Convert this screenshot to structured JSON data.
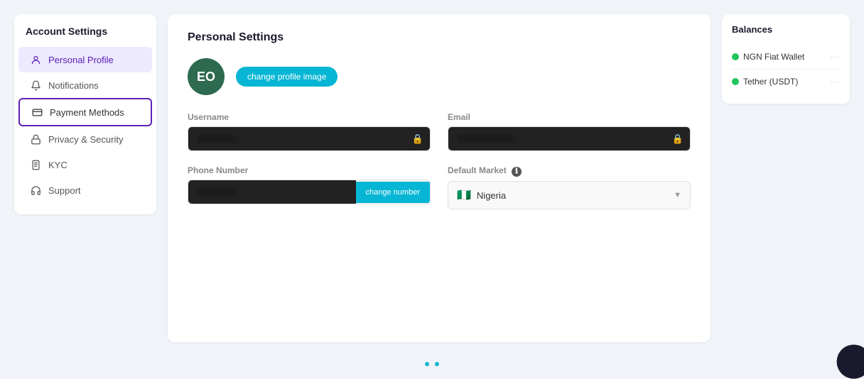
{
  "page": {
    "title": "Account Settings"
  },
  "sidebar": {
    "title": "Account Settings",
    "items": [
      {
        "id": "personal-profile",
        "label": "Personal Profile",
        "icon": "person",
        "active": true,
        "highlighted": false
      },
      {
        "id": "notifications",
        "label": "Notifications",
        "icon": "bell",
        "active": false,
        "highlighted": false
      },
      {
        "id": "payment-methods",
        "label": "Payment Methods",
        "icon": "card",
        "active": false,
        "highlighted": true
      },
      {
        "id": "privacy-security",
        "label": "Privacy & Security",
        "icon": "lock",
        "active": false,
        "highlighted": false
      },
      {
        "id": "kyc",
        "label": "KYC",
        "icon": "document",
        "active": false,
        "highlighted": false
      },
      {
        "id": "support",
        "label": "Support",
        "icon": "headset",
        "active": false,
        "highlighted": false
      }
    ]
  },
  "main": {
    "section_title": "Personal Settings",
    "avatar_initials": "EO",
    "change_image_label": "change profile image",
    "fields": {
      "username_label": "Username",
      "username_value": "redacted",
      "email_label": "Email",
      "email_value": "redacted",
      "phone_label": "Phone Number",
      "phone_value": "redacted",
      "change_number_label": "change number",
      "market_label": "Default Market",
      "market_value": "Nigeria",
      "market_flag": "🇳🇬"
    }
  },
  "right_panel": {
    "title": "Balances",
    "items": [
      {
        "name": "NGN Fiat Wallet",
        "color": "#22c55e"
      },
      {
        "name": "Tether (USDT)",
        "color": "#22c55e"
      }
    ],
    "more_label": "···"
  },
  "bottom_dots": [
    "dot1",
    "dot2"
  ]
}
